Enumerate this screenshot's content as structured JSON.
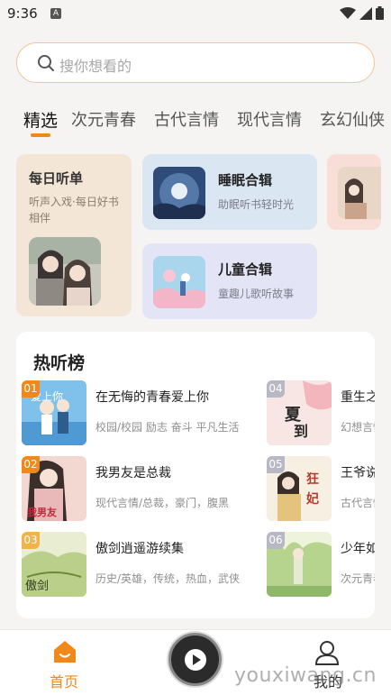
{
  "status": {
    "time": "9:36",
    "notif_letter": "A"
  },
  "search": {
    "placeholder": "搜你想看的"
  },
  "tabs": [
    {
      "label": "精选",
      "active": true
    },
    {
      "label": "次元青春"
    },
    {
      "label": "古代言情"
    },
    {
      "label": "现代言情"
    },
    {
      "label": "玄幻仙侠"
    }
  ],
  "daily": {
    "title": "每日听单",
    "subtitle": "听声入戏·每日好书相伴"
  },
  "collections": [
    {
      "title": "睡眠合辑",
      "subtitle": "助眠听书轻时光"
    },
    {
      "title": "儿童合辑",
      "subtitle": "童趣儿歌听故事"
    }
  ],
  "ranking": {
    "title": "热听榜",
    "items": [
      {
        "rank": "01",
        "name": "在无悔的青春爱上你",
        "tags": "校园/校园 励志 奋斗 平凡生活",
        "badge_color": "#f0891a"
      },
      {
        "rank": "02",
        "name": "我男友是总裁",
        "tags": "现代言情/总裁，豪门，腹黑",
        "badge_color": "#f0891a"
      },
      {
        "rank": "03",
        "name": "傲剑逍遥游续集",
        "tags": "历史/英雄，传统，热血，武侠",
        "badge_color": "#f3b24a"
      },
      {
        "rank": "04",
        "name": "重生之",
        "tags": "幻想言情",
        "badge_color": "#b8b8c4"
      },
      {
        "rank": "05",
        "name": "王爷说堂",
        "tags": "古代言情",
        "badge_color": "#b8b8c4"
      },
      {
        "rank": "06",
        "name": "少年如",
        "tags": "次元青春",
        "badge_color": "#b8b8c4"
      }
    ]
  },
  "bottom_nav": {
    "home": "首页",
    "me": "我的"
  },
  "watermark": "youxiwang.cn",
  "colors": {
    "accent": "#f0891a",
    "background": "#f5f4f3"
  }
}
